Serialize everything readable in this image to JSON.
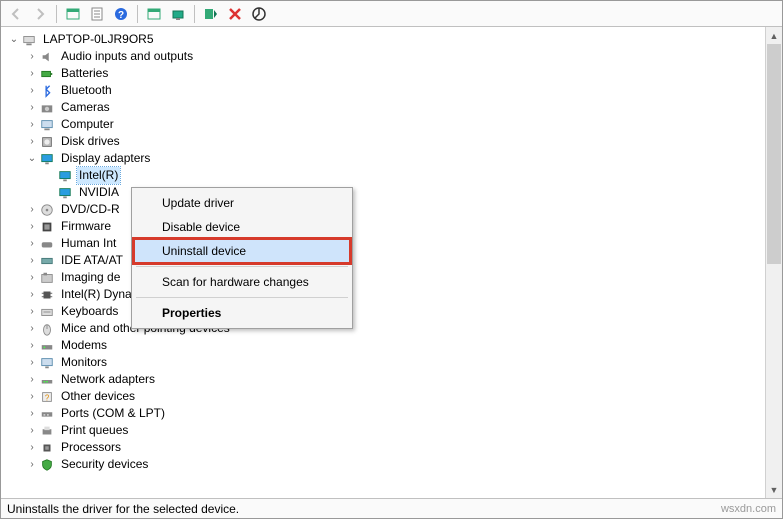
{
  "toolbar": {
    "back": "Back",
    "forward": "Forward",
    "showhidden": "Show hidden devices",
    "properties": "Properties",
    "help": "Help",
    "scan": "Scan for hardware changes",
    "updatedriver": "Update driver",
    "add": "Add legacy hardware",
    "uninstall": "Uninstall device",
    "disable": "Disable device"
  },
  "root": {
    "label": "LAPTOP-0LJR9OR5"
  },
  "categories": [
    {
      "label": "Audio inputs and outputs",
      "icon": "speaker",
      "open": false
    },
    {
      "label": "Batteries",
      "icon": "battery",
      "open": false
    },
    {
      "label": "Bluetooth",
      "icon": "bluetooth",
      "open": false
    },
    {
      "label": "Cameras",
      "icon": "camera",
      "open": false
    },
    {
      "label": "Computer",
      "icon": "computer",
      "open": false
    },
    {
      "label": "Disk drives",
      "icon": "disk",
      "open": false
    },
    {
      "label": "Display adapters",
      "icon": "display",
      "open": true,
      "children": [
        {
          "label": "Intel(R)",
          "icon": "display",
          "selected": true
        },
        {
          "label": "NVIDIA",
          "icon": "display",
          "selected": false
        }
      ]
    },
    {
      "label": "DVD/CD-R",
      "icon": "dvd",
      "open": false,
      "truncated": true
    },
    {
      "label": "Firmware",
      "icon": "firmware",
      "open": false
    },
    {
      "label": "Human Int",
      "icon": "hid",
      "open": false,
      "truncated": true
    },
    {
      "label": "IDE ATA/AT",
      "icon": "ide",
      "open": false,
      "truncated": true
    },
    {
      "label": "Imaging de",
      "icon": "imaging",
      "open": false,
      "truncated": true
    },
    {
      "label": "Intel(R) Dynamic Platform and Thermal Framework",
      "icon": "chip",
      "open": false
    },
    {
      "label": "Keyboards",
      "icon": "keyboard",
      "open": false
    },
    {
      "label": "Mice and other pointing devices",
      "icon": "mouse",
      "open": false
    },
    {
      "label": "Modems",
      "icon": "modem",
      "open": false
    },
    {
      "label": "Monitors",
      "icon": "monitor",
      "open": false
    },
    {
      "label": "Network adapters",
      "icon": "network",
      "open": false
    },
    {
      "label": "Other devices",
      "icon": "other",
      "open": false
    },
    {
      "label": "Ports (COM & LPT)",
      "icon": "ports",
      "open": false
    },
    {
      "label": "Print queues",
      "icon": "printer",
      "open": false
    },
    {
      "label": "Processors",
      "icon": "cpu",
      "open": false
    },
    {
      "label": "Security devices",
      "icon": "security",
      "open": false
    }
  ],
  "context_menu": {
    "items": [
      {
        "label": "Update driver",
        "kind": "item"
      },
      {
        "label": "Disable device",
        "kind": "item"
      },
      {
        "label": "Uninstall device",
        "kind": "item",
        "highlight": true
      },
      {
        "kind": "sep"
      },
      {
        "label": "Scan for hardware changes",
        "kind": "item"
      },
      {
        "kind": "sep"
      },
      {
        "label": "Properties",
        "kind": "item",
        "bold": true
      }
    ]
  },
  "statusbar": {
    "text": "Uninstalls the driver for the selected device."
  },
  "watermark": "wsxdn.com"
}
